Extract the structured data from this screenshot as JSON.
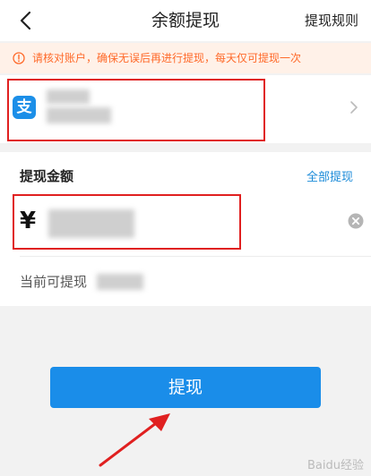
{
  "header": {
    "title": "余额提现",
    "back_icon": "chevron-left-icon",
    "rules_label": "提现规则"
  },
  "notice": {
    "icon": "warning-circle-icon",
    "text": "请核对账户，确保无误后再进行提现，每天仅可提现一次",
    "color": "#ff6a2a"
  },
  "account": {
    "icon_glyph": "支",
    "icon_name": "alipay-icon",
    "brand_color": "#1c8fe8",
    "chevron_icon": "chevron-right-icon"
  },
  "amount": {
    "label": "提现金额",
    "all_label": "全部提现",
    "currency_symbol": "¥",
    "clear_icon": "clear-circle-icon",
    "available_label": "当前可提现"
  },
  "submit": {
    "label": "提现",
    "color": "#1a8de9"
  },
  "watermark": {
    "text": "Baidu经验"
  }
}
